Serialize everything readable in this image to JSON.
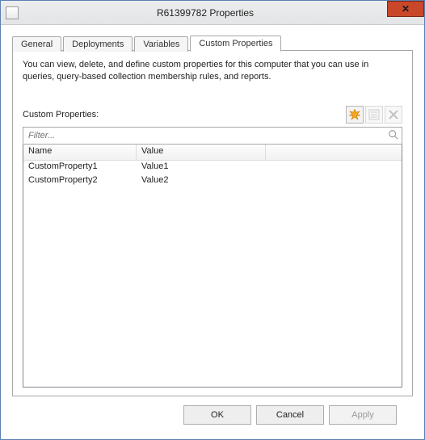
{
  "window": {
    "title": "R61399782 Properties"
  },
  "tabs": [
    {
      "label": "General"
    },
    {
      "label": "Deployments"
    },
    {
      "label": "Variables"
    },
    {
      "label": "Custom Properties"
    }
  ],
  "activeTabIndex": 3,
  "panel": {
    "description": "You can view, delete, and define custom properties for this computer that you can use in queries, query-based collection membership rules, and reports.",
    "listLabel": "Custom Properties:",
    "filterPlaceholder": "Filter...",
    "columns": {
      "name": "Name",
      "value": "Value"
    },
    "rows": [
      {
        "name": "CustomProperty1",
        "value": "Value1"
      },
      {
        "name": "CustomProperty2",
        "value": "Value2"
      }
    ]
  },
  "buttons": {
    "ok": "OK",
    "cancel": "Cancel",
    "apply": "Apply"
  }
}
